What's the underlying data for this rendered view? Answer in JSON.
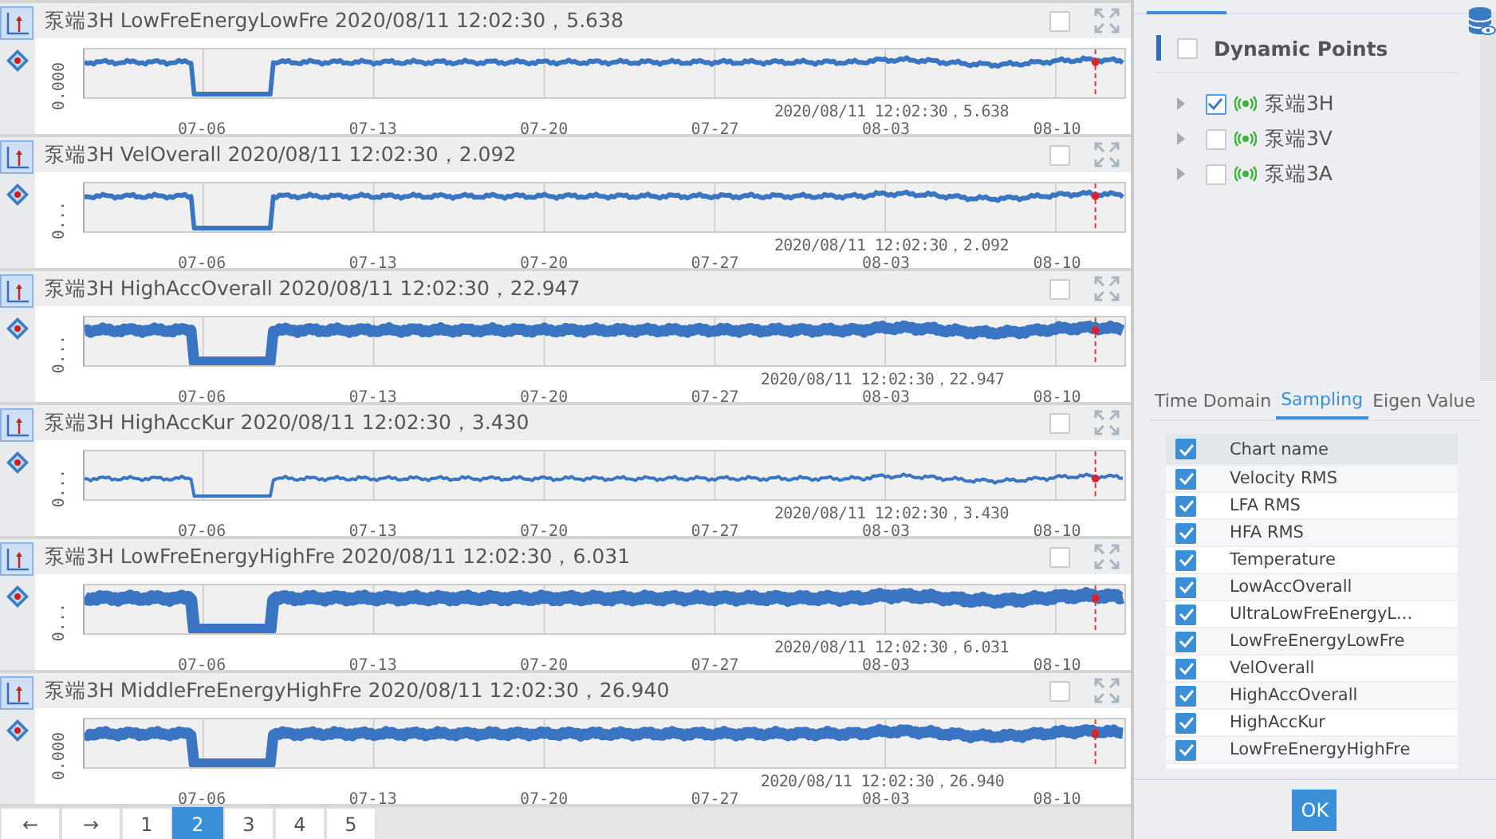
{
  "charts": [
    {
      "title": "泵端3H LowFreEnergyLowFre 2020/08/11 12:02:30，5.638",
      "y_tick": "0.000",
      "cursor_label": "2020/08/11 12:02:30，5.638",
      "x_ticks": [
        "07-06",
        "07-13",
        "07-20",
        "07-27",
        "08-03",
        "08-10"
      ],
      "checked": false,
      "views": [
        {
          "selected": true
        },
        {
          "selected": false
        }
      ]
    },
    {
      "title": "泵端3H VelOverall 2020/08/11 12:02:30，2.092",
      "y_tick": "0...",
      "cursor_label": "2020/08/11 12:02:30，2.092",
      "x_ticks": [
        "07-06",
        "07-13",
        "07-20",
        "07-27",
        "08-03",
        "08-10"
      ],
      "checked": false,
      "views": [
        {
          "selected": true
        },
        {
          "selected": false
        }
      ]
    },
    {
      "title": "泵端3H HighAccOverall 2020/08/11 12:02:30，22.947",
      "y_tick": "0...",
      "cursor_label": "2020/08/11 12:02:30，22.947",
      "x_ticks": [
        "07-06",
        "07-13",
        "07-20",
        "07-27",
        "08-03",
        "08-10"
      ],
      "checked": false,
      "views": [
        {
          "selected": true
        },
        {
          "selected": false
        }
      ]
    },
    {
      "title": "泵端3H HighAccKur 2020/08/11 12:02:30，3.430",
      "y_tick": "0...",
      "cursor_label": "2020/08/11 12:02:30，3.430",
      "x_ticks": [
        "07-06",
        "07-13",
        "07-20",
        "07-27",
        "08-03",
        "08-10"
      ],
      "checked": false,
      "views": [
        {
          "selected": true
        },
        {
          "selected": false
        }
      ]
    },
    {
      "title": "泵端3H LowFreEnergyHighFre 2020/08/11 12:02:30，6.031",
      "y_tick": "0...",
      "cursor_label": "2020/08/11 12:02:30，6.031",
      "x_ticks": [
        "07-06",
        "07-13",
        "07-20",
        "07-27",
        "08-03",
        "08-10"
      ],
      "checked": false,
      "views": [
        {
          "selected": true
        },
        {
          "selected": false
        }
      ]
    },
    {
      "title": "泵端3H MiddleFreEnergyHighFre 2020/08/11 12:02:30，26.940",
      "y_tick": "0.000",
      "cursor_label": "2020/08/11 12:02:30，26.940",
      "x_ticks": [
        "07-06",
        "07-13",
        "07-20",
        "07-27",
        "08-03",
        "08-10"
      ],
      "checked": false,
      "views": [
        {
          "selected": true
        },
        {
          "selected": false
        }
      ]
    }
  ],
  "pagination": {
    "prev": "←",
    "next": "→",
    "pages": [
      {
        "label": "1",
        "selected": false
      },
      {
        "label": "2",
        "selected": true
      },
      {
        "label": "3",
        "selected": false
      },
      {
        "label": "4",
        "selected": false
      },
      {
        "label": "5",
        "selected": false
      }
    ]
  },
  "points_panel": {
    "header": {
      "label": "Dynamic Points",
      "checked": false
    },
    "points": [
      {
        "label": "泵端3H",
        "checked": true
      },
      {
        "label": "泵端3V",
        "checked": false
      },
      {
        "label": "泵端3A",
        "checked": false
      }
    ]
  },
  "tabs": [
    {
      "label": "Time Domain",
      "selected": false
    },
    {
      "label": "Sampling",
      "selected": true
    },
    {
      "label": "Eigen Value",
      "selected": false
    }
  ],
  "table": {
    "header": {
      "label": "Chart name",
      "checked": true
    },
    "rows": [
      {
        "label": "Velocity RMS",
        "checked": true
      },
      {
        "label": "LFA RMS",
        "checked": true
      },
      {
        "label": "HFA RMS",
        "checked": true
      },
      {
        "label": "Temperature",
        "checked": true
      },
      {
        "label": "LowAccOverall",
        "checked": true
      },
      {
        "label": "UltraLowFreEnergyL...",
        "checked": true
      },
      {
        "label": "LowFreEnergyLowFre",
        "checked": true
      },
      {
        "label": "VelOverall",
        "checked": true
      },
      {
        "label": "HighAccOverall",
        "checked": true
      },
      {
        "label": "HighAccKur",
        "checked": true
      },
      {
        "label": "LowFreEnergyHighFre",
        "checked": true
      }
    ]
  },
  "ok_button": "OK"
}
